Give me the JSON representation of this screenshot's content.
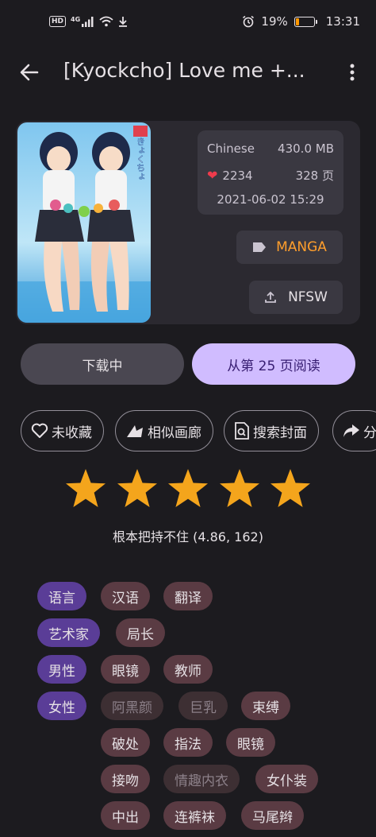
{
  "status_bar": {
    "left_badges": [
      "HD",
      "4G"
    ],
    "battery": "19%",
    "battery_level": 0.19,
    "time": "13:31"
  },
  "app_bar": {
    "title": "[Kyockcho] Love me +..."
  },
  "info": {
    "language": "Chinese",
    "size": "430.0 MB",
    "favorites": "2234",
    "pages": "328 页",
    "date": "2021-06-02 15:29",
    "category": "MANGA",
    "upload_label": "NFSW",
    "cover_title": "きょくちょ"
  },
  "actions": {
    "download": "下载中",
    "read": "从第 25 页阅读"
  },
  "chips": [
    {
      "label": "未收藏",
      "icon": "heart-outline-icon"
    },
    {
      "label": "相似画廊",
      "icon": "similar-icon"
    },
    {
      "label": "搜索封面",
      "icon": "image-search-icon"
    },
    {
      "label": "分",
      "icon": "share-icon"
    }
  ],
  "rating": {
    "stars": 5,
    "text": "根本把持不住 (4.86, 162)"
  },
  "tags": {
    "language": {
      "ns": "语言",
      "values": [
        "汉语",
        "翻译"
      ]
    },
    "artist": {
      "ns": "艺术家",
      "values": [
        "局长"
      ]
    },
    "male": {
      "ns": "男性",
      "values": [
        "眼镜",
        "教师"
      ]
    },
    "female": {
      "ns": "女性",
      "values": [
        "阿黑颜",
        "巨乳",
        "束缚",
        "破处",
        "指法",
        "眼镜",
        "接吻",
        "情趣内衣",
        "女仆装",
        "中出",
        "连裤袜",
        "马尾辫"
      ]
    }
  },
  "colors": {
    "background": "#1c1b1f",
    "primary": "#d0bcff",
    "accent_orange": "#ff9e2c",
    "star": "#f4a51c",
    "heart": "#ef3b4c"
  }
}
